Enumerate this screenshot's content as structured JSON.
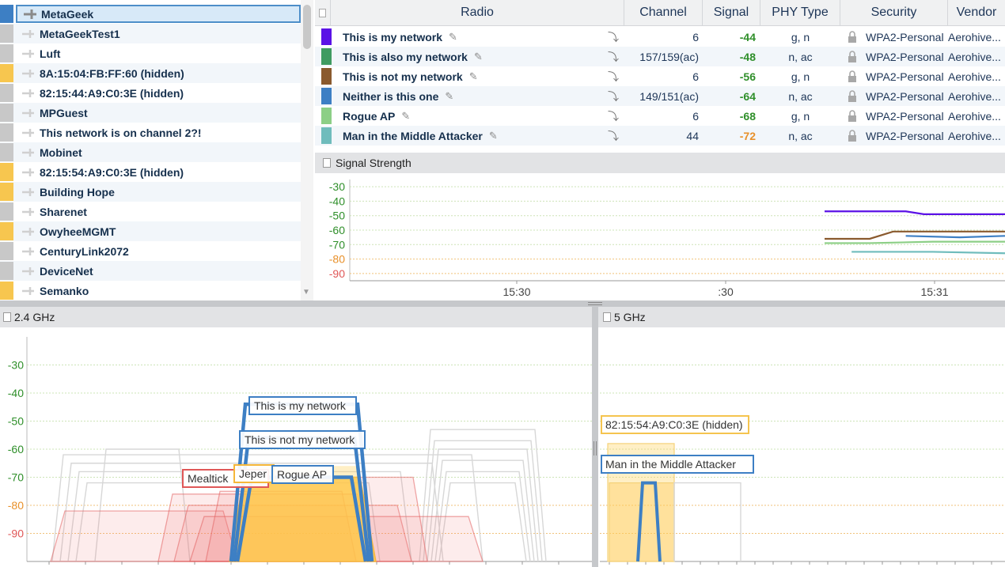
{
  "ssid_list": {
    "items": [
      {
        "name": "MetaGeek",
        "color": "#3d7fc4",
        "selected": true
      },
      {
        "name": "MetaGeekTest1",
        "color": "#c8c8c8"
      },
      {
        "name": "Luft",
        "color": "#c8c8c8"
      },
      {
        "name": "8A:15:04:FB:FF:60 (hidden)",
        "color": "#f7c64f"
      },
      {
        "name": "82:15:44:A9:C0:3E (hidden)",
        "color": "#c8c8c8"
      },
      {
        "name": "MPGuest",
        "color": "#c8c8c8"
      },
      {
        "name": "This network is on channel 2?!",
        "color": "#c8c8c8"
      },
      {
        "name": "Mobinet",
        "color": "#c8c8c8"
      },
      {
        "name": "82:15:54:A9:C0:3E (hidden)",
        "color": "#f7c64f"
      },
      {
        "name": "Building Hope",
        "color": "#f7c64f"
      },
      {
        "name": "Sharenet",
        "color": "#c8c8c8"
      },
      {
        "name": "OwyheeMGMT",
        "color": "#f7c64f"
      },
      {
        "name": "CenturyLink2072",
        "color": "#c8c8c8"
      },
      {
        "name": "DeviceNet",
        "color": "#c8c8c8"
      },
      {
        "name": "Semanko",
        "color": "#f7c64f"
      }
    ]
  },
  "radio_table": {
    "headers": {
      "radio": "Radio",
      "channel": "Channel",
      "signal": "Signal",
      "phy": "PHY Type",
      "security": "Security",
      "vendor": "Vendor"
    },
    "rows": [
      {
        "color": "#5b12e6",
        "name": "This is my network",
        "channel": "6",
        "signal": "-44",
        "signal_level": "green",
        "phy": "g, n",
        "security": "WPA2-Personal",
        "vendor": "Aerohive..."
      },
      {
        "color": "#3f9b61",
        "name": "This is also my network",
        "channel": "157/159(ac)",
        "signal": "-48",
        "signal_level": "green",
        "phy": "n, ac",
        "security": "WPA2-Personal",
        "vendor": "Aerohive..."
      },
      {
        "color": "#8a5a2e",
        "name": "This is not my network",
        "channel": "6",
        "signal": "-56",
        "signal_level": "green",
        "phy": "g, n",
        "security": "WPA2-Personal",
        "vendor": "Aerohive..."
      },
      {
        "color": "#3d7fc4",
        "name": "Neither is this one",
        "channel": "149/151(ac)",
        "signal": "-64",
        "signal_level": "green",
        "phy": "n, ac",
        "security": "WPA2-Personal",
        "vendor": "Aerohive..."
      },
      {
        "color": "#8ccf86",
        "name": "Rogue AP",
        "channel": "6",
        "signal": "-68",
        "signal_level": "green",
        "phy": "g, n",
        "security": "WPA2-Personal",
        "vendor": "Aerohive..."
      },
      {
        "color": "#6fbcbc",
        "name": "Man in the Middle Attacker",
        "channel": "44",
        "signal": "-72",
        "signal_level": "orange",
        "phy": "n, ac",
        "security": "WPA2-Personal",
        "vendor": "Aerohive..."
      }
    ]
  },
  "signal_panel": {
    "title": "Signal Strength"
  },
  "band24": {
    "title": "2.4 GHz"
  },
  "band5": {
    "title": "5 GHz"
  },
  "chart_data": [
    {
      "type": "line",
      "title": "Signal Strength",
      "y_ticks": [
        "-30",
        "-40",
        "-50",
        "-60",
        "-70",
        "-80",
        "-90"
      ],
      "x_ticks": [
        "15:30",
        ":30",
        "15:31"
      ],
      "ylim": [
        -95,
        -25
      ],
      "grid": true,
      "series": [
        {
          "color": "#5b12e6",
          "points": [
            [
              0.0,
              -47
            ],
            [
              0.45,
              -47
            ],
            [
              0.55,
              -49
            ],
            [
              1.0,
              -49
            ]
          ]
        },
        {
          "color": "#3d7fc4",
          "points": [
            [
              0.45,
              -64
            ],
            [
              0.75,
              -65
            ],
            [
              1.0,
              -64
            ]
          ]
        },
        {
          "color": "#8a5a2e",
          "points": [
            [
              0.0,
              -66
            ],
            [
              0.25,
              -66
            ],
            [
              0.38,
              -61
            ],
            [
              1.0,
              -61
            ]
          ]
        },
        {
          "color": "#8ccf86",
          "points": [
            [
              0.0,
              -69
            ],
            [
              0.25,
              -69
            ],
            [
              0.6,
              -68
            ],
            [
              1.0,
              -68
            ]
          ]
        },
        {
          "color": "#6fbcbc",
          "points": [
            [
              0.15,
              -75
            ],
            [
              0.6,
              -75
            ],
            [
              1.0,
              -76
            ]
          ]
        }
      ]
    },
    {
      "type": "area",
      "title": "2.4 GHz",
      "y_ticks": [
        "-30",
        "-40",
        "-50",
        "-60",
        "-70",
        "-80",
        "-90"
      ],
      "ylim": [
        -100,
        -20
      ],
      "labels": [
        "This is my network",
        "This is not my network",
        "Rogue AP",
        "Mealtick",
        "Jeper"
      ]
    },
    {
      "type": "area",
      "title": "5 GHz",
      "labels": [
        "82:15:54:A9:C0:3E (hidden)",
        "Man in the Middle Attacker"
      ]
    }
  ]
}
